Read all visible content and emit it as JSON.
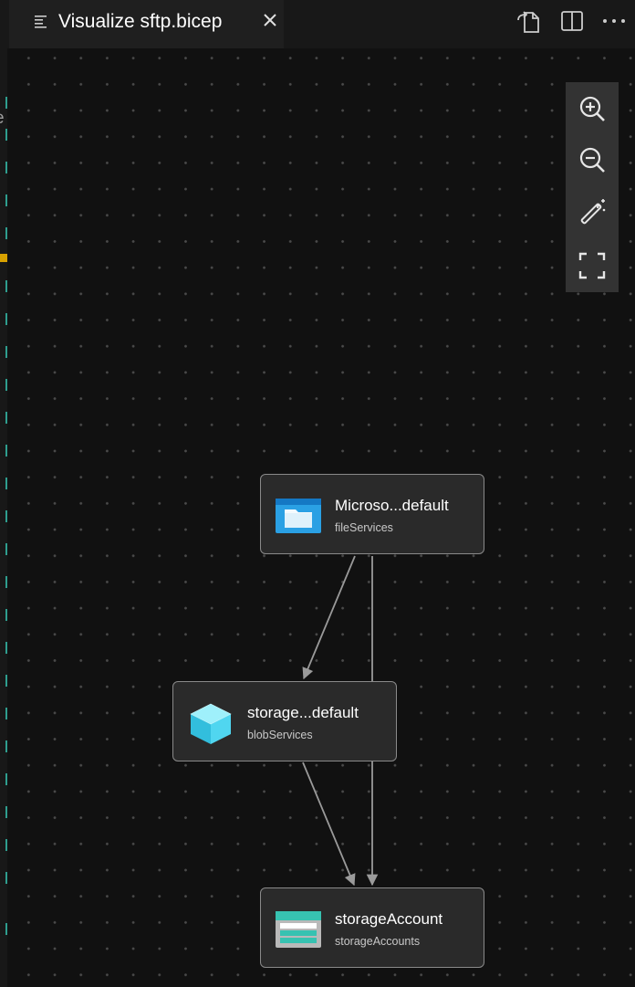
{
  "tab": {
    "title": "Visualize sftp.bicep"
  },
  "toolbar": {
    "open_source_icon": "open-source-file-icon",
    "split_icon": "split-editor-icon",
    "more_icon": "more-actions-icon"
  },
  "edge_gutter": {
    "letter": "e"
  },
  "zoom_controls": [
    {
      "icon": "zoom-in-icon"
    },
    {
      "icon": "zoom-out-icon"
    },
    {
      "icon": "magic-wand-layout-icon"
    },
    {
      "icon": "fit-to-screen-icon"
    }
  ],
  "graph": {
    "nodes": [
      {
        "id": "fileServices",
        "name": "Microso...default",
        "type": "fileServices",
        "icon": "file-services-icon"
      },
      {
        "id": "blobServices",
        "name": "storage...default",
        "type": "blobServices",
        "icon": "blob-services-icon"
      },
      {
        "id": "storageAccount",
        "name": "storageAccount",
        "type": "storageAccounts",
        "icon": "storage-account-icon"
      }
    ],
    "edges": [
      {
        "from": "fileServices",
        "to": "blobServices"
      },
      {
        "from": "fileServices",
        "to": "storageAccount"
      },
      {
        "from": "blobServices",
        "to": "storageAccount"
      }
    ]
  },
  "colors": {
    "canvas": "#111111",
    "node_bg": "#2a2a2a",
    "node_border": "#8a8a8a",
    "edge": "#9a9a9a",
    "accent_teal": "#2f9e8f",
    "warning": "#d7a100"
  }
}
